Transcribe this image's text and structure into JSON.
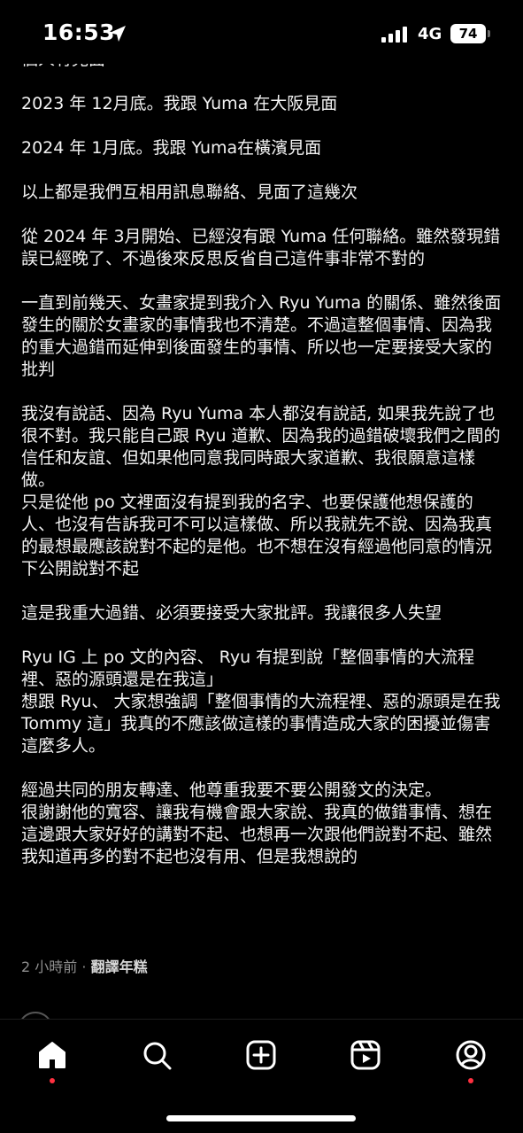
{
  "status_bar": {
    "time": "16:53",
    "network": "4G",
    "battery": "74"
  },
  "post": {
    "paragraphs": [
      "個人有見面",
      "2023 年 12月底。我跟 Yuma 在大阪見面",
      "2024 年 1月底。我跟 Yuma在橫濱見面",
      "以上都是我們互相用訊息聯絡、見面了這幾次",
      "從 2024 年 3月開始、已經沒有跟 Yuma 任何聯絡。雖然發現錯誤已經晚了、不過後來反思反省自己這件事非常不對的",
      "一直到前幾天、女畫家提到我介入 Ryu Yuma 的關係、雖然後面發生的關於女畫家的事情我也不清楚。不過這整個事情、因為我的重大過錯而延伸到後面發生的事情、所以也一定要接受大家的批判",
      "我沒有說話、因為 Ryu Yuma 本人都沒有說話, 如果我先說了也很不對。我只能自己跟 Ryu 道歉、因為我的過錯破壞我們之間的信任和友誼、但如果他同意我同時跟大家道歉、我很願意這樣做。",
      "只是從他 po 文裡面沒有提到我的名字、也要保護他想保護的人、也沒有告訴我可不可以這樣做、所以我就先不說、因為我真的最想最應該說對不起的是他。也不想在沒有經過他同意的情況下公開說對不起",
      "這是我重大過錯、必須要接受大家批評。我讓很多人失望",
      "Ryu IG 上 po 文的內容、 Ryu 有提到說「整個事情的大流程裡、惡的源頭還是在我這」",
      "想跟 Ryu、 大家想強調「整個事情的大流程裡、惡的源頭是在我 Tommy 這」我真的不應該做這樣的事情造成大家的困擾並傷害這麼多人。",
      "經過共同的朋友轉達、他尊重我要不要公開發文的決定。",
      "很謝謝他的寬容、讓我有機會跟大家說、我真的做錯事情、想在這邊跟大家好好的講對不起、也想再一次跟他們說對不起、雖然我知道再多的對不起也沒有用、但是我想說的"
    ],
    "timestamp": "2 小時前",
    "separator": "·",
    "translate_label": "翻譯年糕"
  },
  "tab_bar": {
    "items": [
      "home",
      "search",
      "create",
      "reels",
      "profile"
    ],
    "accent_color": "#ff3040"
  }
}
